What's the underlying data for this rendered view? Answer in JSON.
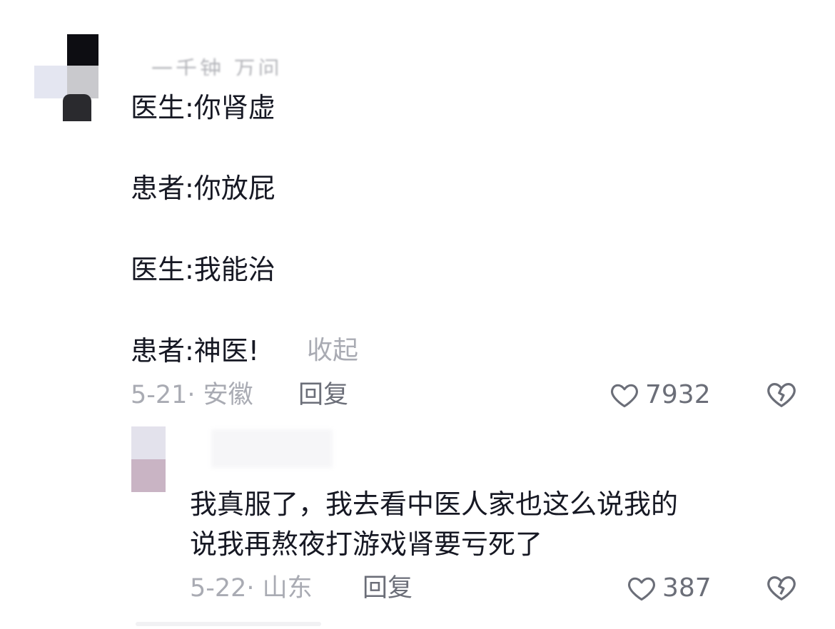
{
  "comment": {
    "username_blurred": "一千钟 万问",
    "lines": [
      "医生:你肾虚",
      "患者:你放屁",
      "医生:我能治",
      "患者:神医!"
    ],
    "collapse_label": "收起",
    "date_location": "5-21· 安徽",
    "reply_label": "回复",
    "like_count": "7932"
  },
  "sub_reply": {
    "lines": [
      "我真服了，我去看中医人家也这么说我的",
      "说我再熬夜打游戏肾要亏死了"
    ],
    "date_location": "5-22· 山东",
    "reply_label": "回复",
    "like_count": "387"
  },
  "icons": {
    "like": "heart-outline-icon",
    "dislike": "broken-heart-icon"
  },
  "colors": {
    "text_primary": "#161823",
    "text_secondary": "#a9abb3",
    "icon_gray": "#6b6e78"
  }
}
